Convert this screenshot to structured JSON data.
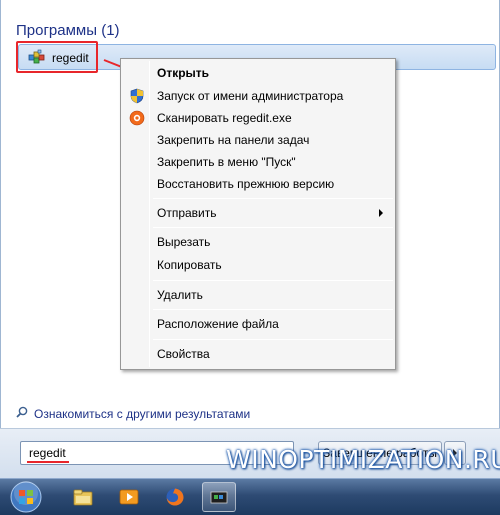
{
  "start_menu": {
    "section_header": "Программы (1)",
    "result": {
      "label": "regedit",
      "icon": "regedit-icon"
    },
    "more_results_label": "Ознакомиться с другими результатами",
    "search": {
      "value": "regedit"
    },
    "shutdown_label": "Завершение работы"
  },
  "context_menu": {
    "items": [
      {
        "label": "Открыть",
        "bold": true
      },
      {
        "label": "Запуск от имени администратора",
        "icon": "uac-shield-icon"
      },
      {
        "label": "Сканировать regedit.exe",
        "icon": "antivirus-icon"
      },
      {
        "label": "Закрепить на панели задач"
      },
      {
        "label": "Закрепить в меню \"Пуск\""
      },
      {
        "label": "Восстановить прежнюю версию"
      },
      {
        "label": "Отправить",
        "submenu": true
      },
      {
        "label": "Вырезать"
      },
      {
        "label": "Копировать"
      },
      {
        "label": "Удалить"
      },
      {
        "label": "Расположение файла"
      },
      {
        "label": "Свойства"
      }
    ]
  },
  "watermark": "WINOPTIMIZATION.RU",
  "taskbar": {
    "items": [
      "start-orb",
      "explorer-icon",
      "media-player-icon",
      "firefox-icon",
      "regedit-taskbar-icon"
    ]
  },
  "colors": {
    "accent_red": "#e8262b",
    "header_blue": "#1e3287"
  }
}
